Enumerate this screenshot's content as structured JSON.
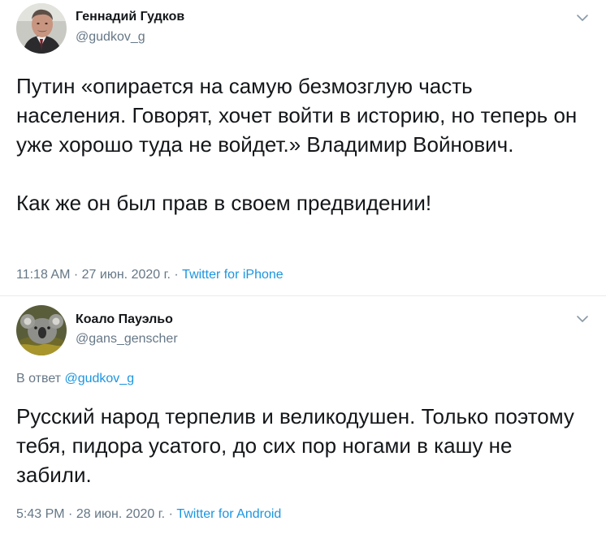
{
  "tweets": [
    {
      "author_name": "Геннадий Гудков",
      "author_handle": "@gudkov_g",
      "avatar": "portrait-photo",
      "text_paragraphs": [
        "Путин «опирается на самую безмозглую часть населения. Говорят, хочет войти в историю, но теперь он уже хорошо туда не войдет.» Владимир Войнович.",
        "Как же он был прав в своем предвидении!"
      ],
      "time": "11:18 AM",
      "date": "27 июн. 2020 г.",
      "source": "Twitter for iPhone",
      "separator": "·"
    },
    {
      "author_name": "Коало Пауэльо",
      "author_handle": "@gans_genscher",
      "avatar": "koala-photo",
      "reply_prefix": "В ответ",
      "reply_to": "@gudkov_g",
      "text_paragraphs": [
        "Русский народ терпелив и великодушен. Только поэтому тебя, пидора усатого, до сих пор ногами в кашу не забили."
      ],
      "time": "5:43 PM",
      "date": "28 июн. 2020 г.",
      "source": "Twitter for Android",
      "separator": "·"
    }
  ],
  "colors": {
    "text": "#14171a",
    "secondary": "#657786",
    "link": "#1b95e0",
    "divider": "#e6ecf0"
  },
  "icons": {
    "menu": "chevron-down-icon"
  }
}
